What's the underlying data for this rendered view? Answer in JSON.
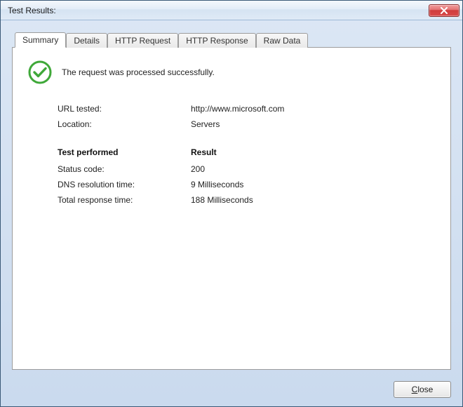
{
  "window": {
    "title": "Test Results:"
  },
  "tabs": {
    "summary": "Summary",
    "details": "Details",
    "http_request": "HTTP Request",
    "http_response": "HTTP Response",
    "raw_data": "Raw Data",
    "active": "summary"
  },
  "status": {
    "icon": "check-circle",
    "message": "The request was processed successfully."
  },
  "info": {
    "url_tested_label": "URL tested:",
    "url_tested_value": "http://www.microsoft.com",
    "location_label": "Location:",
    "location_value": "Servers"
  },
  "headers": {
    "test_performed": "Test performed",
    "result": "Result"
  },
  "results": [
    {
      "label": "Status code:",
      "value": "200"
    },
    {
      "label": "DNS resolution time:",
      "value": "9 Milliseconds"
    },
    {
      "label": "Total response time:",
      "value": "188 Milliseconds"
    }
  ],
  "buttons": {
    "close": "Close"
  }
}
